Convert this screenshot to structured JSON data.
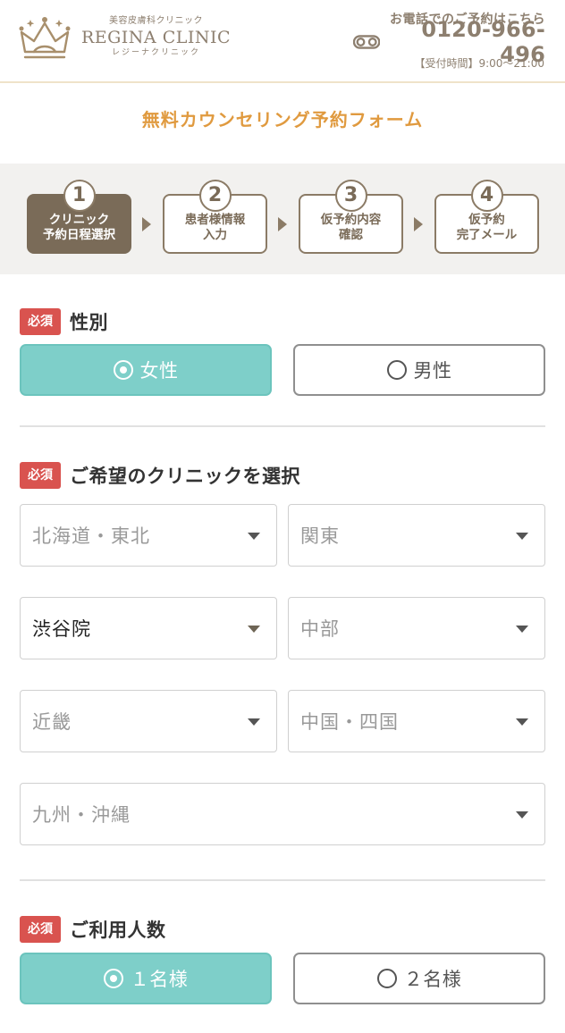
{
  "header": {
    "clinic_type": "美容皮膚科クリニック",
    "brand_name": "REGINA CLINIC",
    "brand_kana": "レジーナクリニック",
    "tel_lead": "お電話でのご予約はこちら",
    "tel_number": "0120-966-496",
    "tel_hours": "【受付時間】9:00～21:00"
  },
  "form_title": "無料カウンセリング予約フォーム",
  "steps": [
    {
      "num": "1",
      "line1": "クリニック",
      "line2": "予約日程選択",
      "active": true
    },
    {
      "num": "2",
      "line1": "患者様情報",
      "line2": "入力",
      "active": false
    },
    {
      "num": "3",
      "line1": "仮予約内容",
      "line2": "確認",
      "active": false
    },
    {
      "num": "4",
      "line1": "仮予約",
      "line2": "完了メール",
      "active": false
    }
  ],
  "required_badge": "必須",
  "gender": {
    "label": "性別",
    "options": [
      {
        "label": "女性",
        "selected": true
      },
      {
        "label": "男性",
        "selected": false
      }
    ]
  },
  "clinic": {
    "label": "ご希望のクリニックを選択",
    "selects": [
      {
        "value": "北海道・東北",
        "filled": false
      },
      {
        "value": "関東",
        "filled": false
      },
      {
        "value": "渋谷院",
        "filled": true
      },
      {
        "value": "中部",
        "filled": false
      },
      {
        "value": "近畿",
        "filled": false
      },
      {
        "value": "中国・四国",
        "filled": false
      },
      {
        "value": "九州・沖縄",
        "filled": false
      }
    ]
  },
  "people": {
    "label": "ご利用人数",
    "options": [
      {
        "label": "１名様",
        "selected": true
      },
      {
        "label": "２名様",
        "selected": false
      }
    ]
  },
  "colors": {
    "accent_orange": "#e09a3f",
    "brand_brown": "#7a6b58",
    "teal_selected": "#7ecfc9",
    "required_red": "#d9534f"
  }
}
